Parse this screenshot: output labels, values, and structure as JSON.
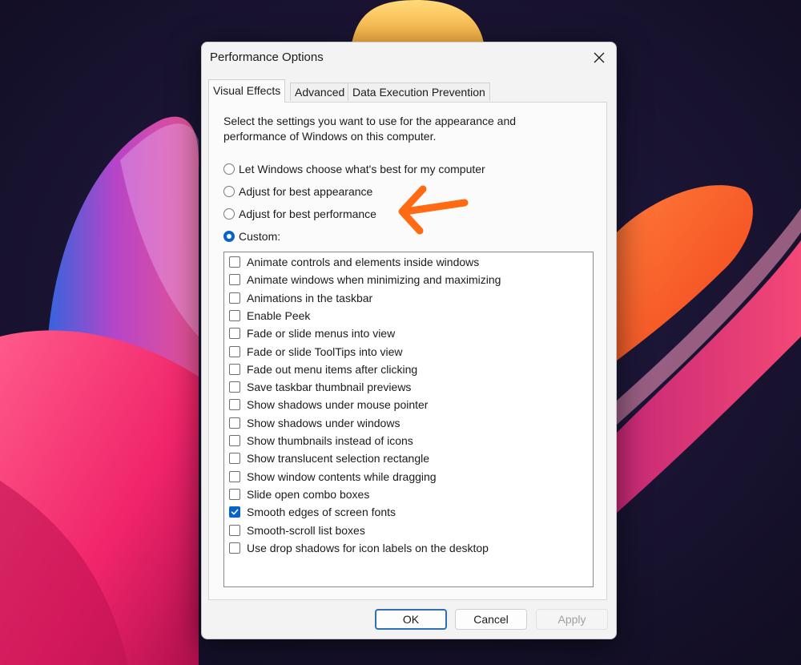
{
  "dialog": {
    "title": "Performance Options",
    "tabs": [
      {
        "label": "Visual Effects"
      },
      {
        "label": "Advanced"
      },
      {
        "label": "Data Execution Prevention"
      }
    ],
    "description": "Select the settings you want to use for the appearance and performance of Windows on this computer.",
    "radio_options": [
      {
        "label": "Let Windows choose what's best for my computer",
        "selected": false
      },
      {
        "label": "Adjust for best appearance",
        "selected": false
      },
      {
        "label": "Adjust for best performance",
        "selected": false
      },
      {
        "label": "Custom:",
        "selected": true
      }
    ],
    "effects": [
      {
        "label": "Animate controls and elements inside windows",
        "checked": false
      },
      {
        "label": "Animate windows when minimizing and maximizing",
        "checked": false
      },
      {
        "label": "Animations in the taskbar",
        "checked": false
      },
      {
        "label": "Enable Peek",
        "checked": false
      },
      {
        "label": "Fade or slide menus into view",
        "checked": false
      },
      {
        "label": "Fade or slide ToolTips into view",
        "checked": false
      },
      {
        "label": "Fade out menu items after clicking",
        "checked": false
      },
      {
        "label": "Save taskbar thumbnail previews",
        "checked": false
      },
      {
        "label": "Show shadows under mouse pointer",
        "checked": false
      },
      {
        "label": "Show shadows under windows",
        "checked": false
      },
      {
        "label": "Show thumbnails instead of icons",
        "checked": false
      },
      {
        "label": "Show translucent selection rectangle",
        "checked": false
      },
      {
        "label": "Show window contents while dragging",
        "checked": false
      },
      {
        "label": "Slide open combo boxes",
        "checked": false
      },
      {
        "label": "Smooth edges of screen fonts",
        "checked": true
      },
      {
        "label": "Smooth-scroll list boxes",
        "checked": false
      },
      {
        "label": "Use drop shadows for icon labels on the desktop",
        "checked": false
      }
    ],
    "buttons": {
      "ok": "OK",
      "cancel": "Cancel",
      "apply": "Apply"
    }
  },
  "icons": {
    "close": "close-icon",
    "annotation": "arrow-left-icon",
    "checkmark": "checkmark-icon"
  },
  "colors": {
    "accent": "#0a64c8",
    "annotation_arrow": "#ff6a13"
  }
}
